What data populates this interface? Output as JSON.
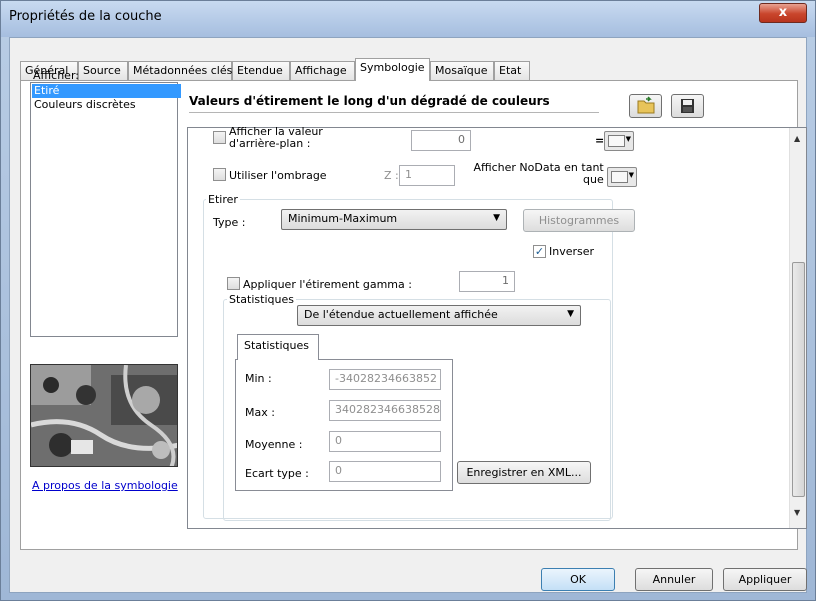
{
  "window": {
    "title": "Propriétés de la couche",
    "close_label": "x"
  },
  "tabs": [
    {
      "label": "Général"
    },
    {
      "label": "Source"
    },
    {
      "label": "Métadonnées clés"
    },
    {
      "label": "Etendue"
    },
    {
      "label": "Affichage"
    },
    {
      "label": "Symbologie"
    },
    {
      "label": "Mosaïque"
    },
    {
      "label": "Etat"
    }
  ],
  "active_tab": "Symbologie",
  "sidebar": {
    "show_label": "Afficher:",
    "items": [
      {
        "label": "Etiré",
        "selected": true
      },
      {
        "label": "Couleurs discrètes",
        "selected": false
      }
    ],
    "about_link": "A propos de la symbologie"
  },
  "panel": {
    "heading": "Valeurs d'étirement le long d'un dégradé de couleurs",
    "background": {
      "checkbox_label_line1": "Afficher la valeur",
      "checkbox_label_line2": "d'arrière-plan :",
      "checked": false,
      "value": "0",
      "equals": "="
    },
    "hillshade": {
      "checkbox_label": "Utiliser l'ombrage",
      "checked": false,
      "z_label": "Z :",
      "z_value": "1",
      "nodata_label_line1": "Afficher NoData en tant",
      "nodata_label_line2": "que"
    },
    "stretch": {
      "group_label": "Etirer",
      "type_label": "Type :",
      "type_value": "Minimum-Maximum",
      "histograms_button": "Histogrammes",
      "invert_label": "Inverser",
      "invert_checked": true,
      "gamma_label": "Appliquer l'étirement gamma :",
      "gamma_checked": false,
      "gamma_value": "1"
    },
    "statistics": {
      "group_label": "Statistiques",
      "source_value": "De l'étendue actuellement affichée",
      "tab_label": "Statistiques",
      "min_label": "Min :",
      "min_value": "-34028234663852",
      "max_label": "Max :",
      "max_value": "340282346638528",
      "mean_label": "Moyenne :",
      "mean_value": "0",
      "std_label": "Ecart type :",
      "std_value": "0",
      "save_xml_button": "Enregistrer en XML..."
    }
  },
  "footer": {
    "ok": "OK",
    "cancel": "Annuler",
    "apply": "Appliquer"
  },
  "colors": {
    "selection": "#3399ff",
    "close_button": "#c9452c",
    "link": "#0000cc"
  }
}
